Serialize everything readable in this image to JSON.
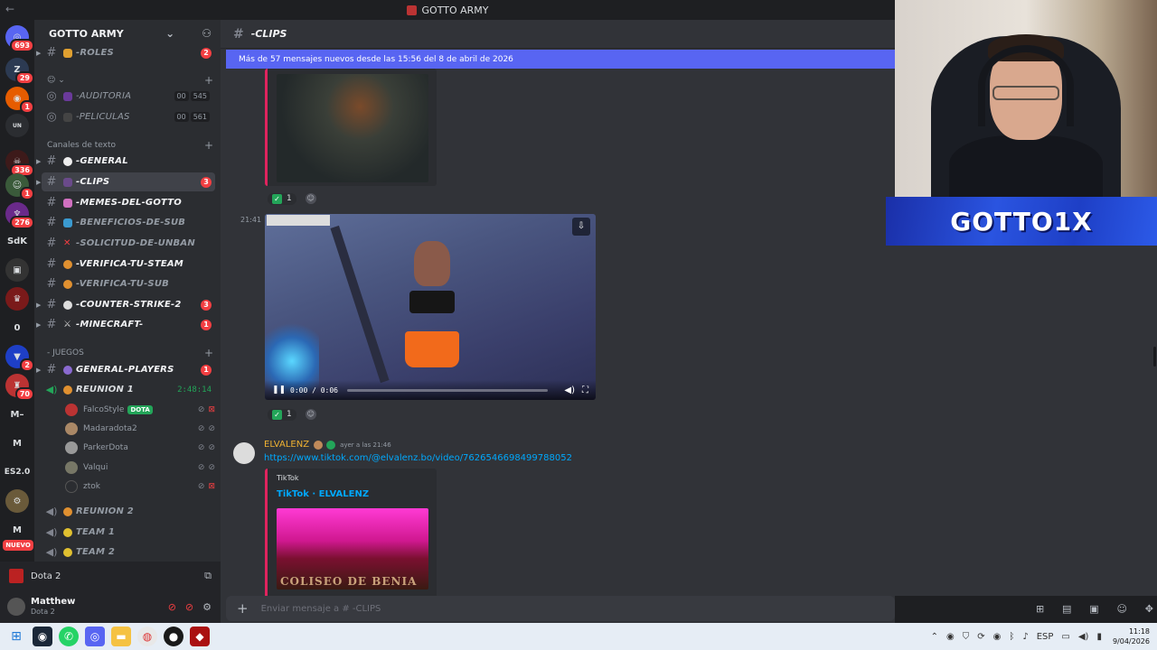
{
  "window": {
    "title": "GOTTO ARMY"
  },
  "rail": {
    "badges": [
      "693",
      "29",
      "1",
      "336",
      "1",
      "276",
      "2",
      "70",
      "1"
    ],
    "labels": {
      "sdk": "SdK",
      "zero": "0",
      "m1": "M–",
      "m2": "M",
      "es": "ES2.0",
      "m3": "M"
    },
    "nuevo": "NUEVO"
  },
  "server": {
    "name": "GOTTO ARMY"
  },
  "sidebar": {
    "roles": {
      "label": "-ROLES",
      "badge": "2"
    },
    "auditoria": {
      "label": "-AUDITORIA",
      "p1": "00",
      "p2": "545"
    },
    "peliculas": {
      "label": "-PELICULAS",
      "p1": "00",
      "p2": "561"
    },
    "cat_text": "Canales de texto",
    "channels": [
      {
        "label": "-GENERAL",
        "badge": ""
      },
      {
        "label": "-CLIPS",
        "badge": "3"
      },
      {
        "label": "-MEMES-DEL-GOTTO",
        "badge": ""
      },
      {
        "label": "-BENEFICIOS-DE-SUB",
        "badge": ""
      },
      {
        "label": "-SOLICITUD-DE-UNBAN",
        "badge": ""
      },
      {
        "label": "-VERIFICA-TU-STEAM",
        "badge": ""
      },
      {
        "label": "-VERIFICA-TU-SUB",
        "badge": ""
      },
      {
        "label": "-COUNTER-STRIKE-2",
        "badge": "3"
      },
      {
        "label": "-MINECRAFT-",
        "badge": "1"
      }
    ],
    "cat_juegos": "- JUEGOS",
    "general_players": {
      "label": "GENERAL-PLAYERS",
      "badge": "1"
    },
    "reunion1": {
      "label": "REUNION 1",
      "timer": "2:48:14"
    },
    "voice_users": [
      {
        "name": "FalcoStyle",
        "tag": "DOTA"
      },
      {
        "name": "Madaradota2",
        "tag": ""
      },
      {
        "name": "ParkerDota",
        "tag": ""
      },
      {
        "name": "Valqui",
        "tag": ""
      },
      {
        "name": "ztok",
        "tag": ""
      }
    ],
    "reunion2": "REUNION 2",
    "team1": "TEAM 1",
    "team2": "TEAM 2"
  },
  "voice_panel": {
    "game": "Dota 2"
  },
  "user_panel": {
    "name": "Matthew",
    "status": "Dota 2"
  },
  "chat": {
    "channel": "-CLIPS",
    "new_messages": "Más de 57 mensajes nuevos desde las 15:56 del 8 de abril de 2026",
    "reaction1": "1",
    "video_time_label": "21:41",
    "video_time": "0:00 / 0:06",
    "reaction2": "1",
    "message": {
      "author": "ELVALENZ",
      "timestamp": "ayer a las 21:46",
      "link": "https://www.tiktok.com/@elvalenz.bo/video/7626546698499788052",
      "embed_provider": "TikTok",
      "embed_title": "TikTok · ELVALENZ",
      "embed_image_text": "COLISEO DE BENIA"
    },
    "composer_placeholder": "Enviar mensaje a # -CLIPS"
  },
  "stream": {
    "nameplate": "GOTTO1X"
  },
  "taskbar": {
    "lang": "ESP",
    "time": "11:18",
    "date": "9/04/2026"
  }
}
